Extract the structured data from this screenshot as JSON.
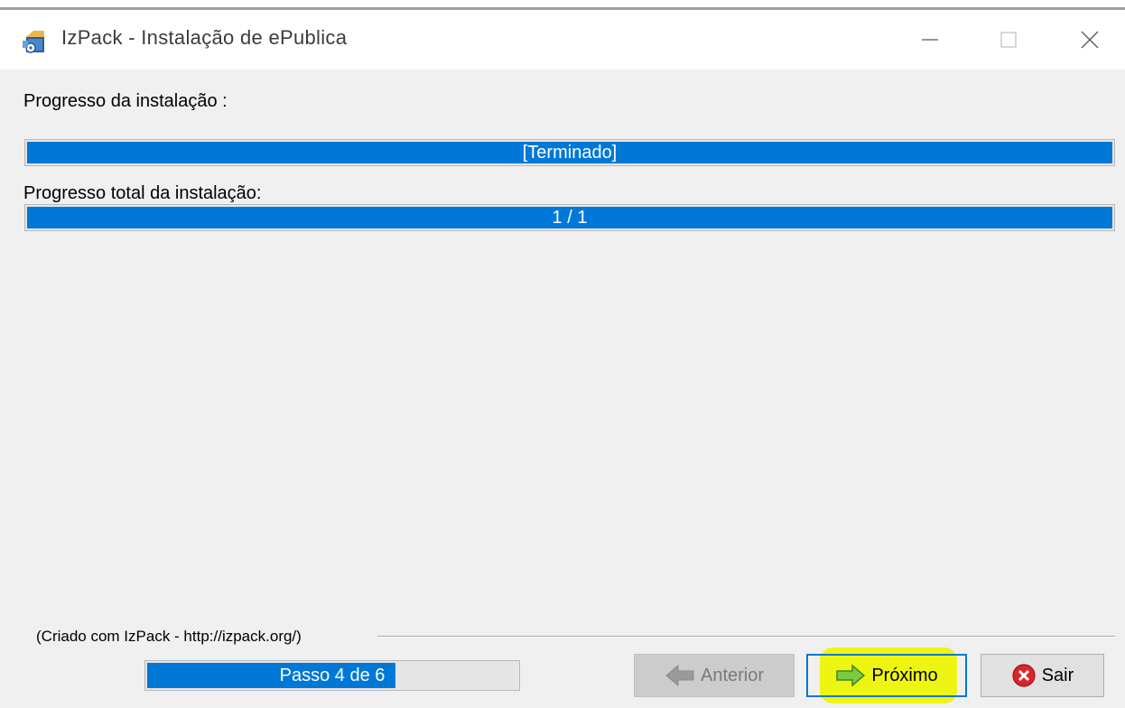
{
  "window": {
    "title": "IzPack - Instalação de  ePublica",
    "icon": "installer-app-icon",
    "controls": [
      "minimize-icon",
      "maximize-icon",
      "close-icon"
    ]
  },
  "install_progress": {
    "label": "Progresso da instalação :",
    "bar_text": "[Terminado]",
    "fraction": 1.0
  },
  "total_progress": {
    "label": "Progresso total da instalação:",
    "bar_text": "1 / 1",
    "fraction": 1.0
  },
  "footer": {
    "credit": "(Criado com IzPack - http://izpack.org/)",
    "step_text": "Passo 4 de 6",
    "step_fraction": 0.67
  },
  "buttons": {
    "previous": {
      "label": "Anterior",
      "icon": "arrow-left-icon",
      "enabled": false
    },
    "next": {
      "label": "Próximo",
      "icon": "arrow-right-icon",
      "enabled": true,
      "highlighted": true,
      "highlight_color": "#eef500"
    },
    "exit": {
      "label": "Sair",
      "icon": "close-circle-icon"
    }
  },
  "colors": {
    "progress_fill": "#0078d7",
    "background": "#f0f0f0"
  }
}
